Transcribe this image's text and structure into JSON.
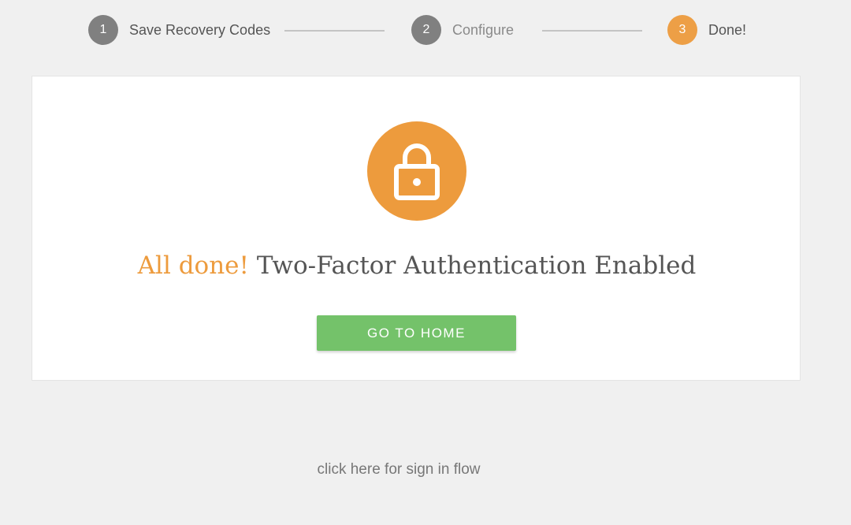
{
  "stepper": {
    "steps": [
      {
        "number": "1",
        "label": "Save Recovery Codes",
        "state": "completed",
        "color": "#7b7b7b"
      },
      {
        "number": "2",
        "label": "Configure",
        "state": "completed",
        "color": "#7b7b7b"
      },
      {
        "number": "3",
        "label": "Done!",
        "state": "active",
        "color": "#ed9b3d"
      }
    ]
  },
  "card": {
    "icon": "lock-icon",
    "icon_color": "#ed9b3d",
    "headline_accent": "All done!",
    "headline_text": "Two-Factor Authentication Enabled",
    "button_label": "GO TO HOME",
    "button_color": "#74c26a"
  },
  "footer": {
    "link_text": "click here for sign in flow"
  }
}
